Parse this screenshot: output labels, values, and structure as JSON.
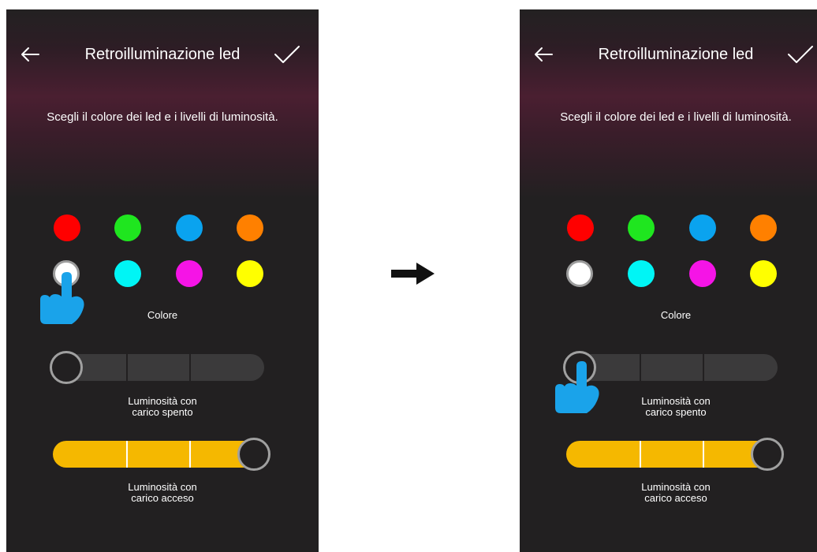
{
  "screens": [
    {
      "title": "Retroilluminazione led",
      "subtitle": "Scegli il colore dei led e i livelli di luminosità.",
      "color_label": "Colore",
      "slider_off": {
        "label_line1": "Luminosità con",
        "label_line2": "carico spento",
        "level": 0
      },
      "slider_on": {
        "label_line1": "Luminosità con",
        "label_line2": "carico acceso",
        "level": 1
      },
      "hand_target": "color-white"
    },
    {
      "title": "Retroilluminazione led",
      "subtitle": "Scegli il colore dei led e i livelli di luminosità.",
      "color_label": "Colore",
      "slider_off": {
        "label_line1": "Luminosità con",
        "label_line2": "carico spento",
        "level": 0
      },
      "slider_on": {
        "label_line1": "Luminosità con",
        "label_line2": "carico acceso",
        "level": 1
      },
      "hand_target": "slider-off-knob"
    }
  ],
  "colors": [
    {
      "name": "red",
      "hex": "#ff0000"
    },
    {
      "name": "green",
      "hex": "#1fe61f"
    },
    {
      "name": "blue",
      "hex": "#0aa3ef"
    },
    {
      "name": "orange",
      "hex": "#ff8000"
    },
    {
      "name": "white",
      "hex": "#ffffff",
      "selected": true
    },
    {
      "name": "cyan",
      "hex": "#00f5f5"
    },
    {
      "name": "magenta",
      "hex": "#f514e6"
    },
    {
      "name": "yellow",
      "hex": "#ffff00"
    }
  ],
  "icons": {
    "back": "arrow-left-icon",
    "confirm": "check-icon",
    "pointer": "hand-pointer-icon",
    "transition": "arrow-right-icon"
  },
  "theme": {
    "accent": "#f5b800",
    "hand": "#1aa3ea",
    "background": "#222021"
  }
}
